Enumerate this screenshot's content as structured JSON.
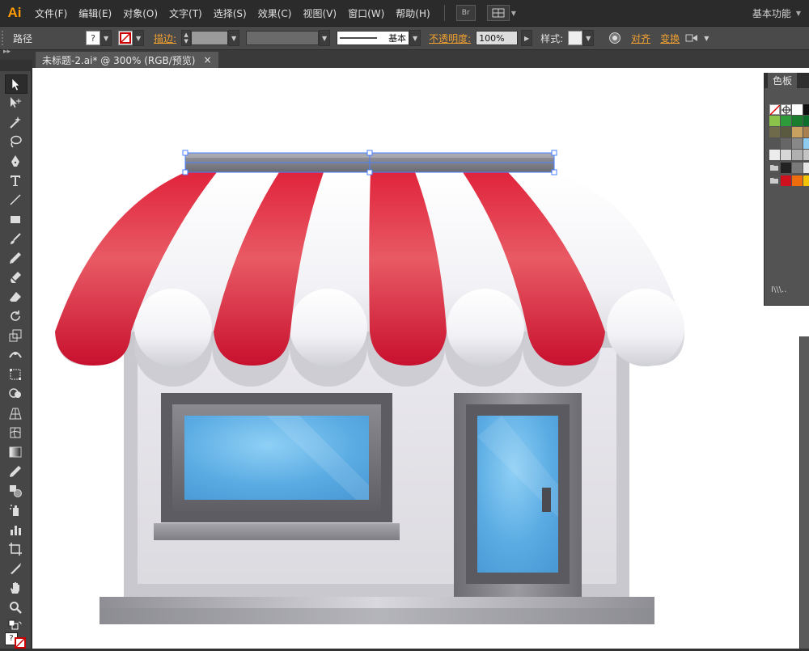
{
  "app": {
    "logo": "Ai",
    "workspace": "基本功能",
    "bridge": "Br"
  },
  "menu": [
    "文件(F)",
    "编辑(E)",
    "对象(O)",
    "文字(T)",
    "选择(S)",
    "效果(C)",
    "视图(V)",
    "窗口(W)",
    "帮助(H)"
  ],
  "control": {
    "object_type": "路径",
    "fill_symbol": "?",
    "stroke_label": "描边:",
    "stroke_profile": "基本",
    "opacity_label": "不透明度:",
    "opacity_value": "100%",
    "style_label": "样式:",
    "align_label": "对齐",
    "transform_label": "变换"
  },
  "document": {
    "tab_title": "未标题-2.ai* @ 300% (RGB/预览)",
    "close": "×"
  },
  "swatches_panel": {
    "title": "色板",
    "footer": "I\\\\\\.."
  },
  "toolbar": {
    "tools": [
      "selection-tool",
      "direct-selection-tool",
      "magic-wand-tool",
      "lasso-tool",
      "pen-tool",
      "type-tool",
      "line-tool",
      "rectangle-tool",
      "paintbrush-tool",
      "pencil-tool",
      "blob-brush-tool",
      "eraser-tool",
      "rotate-tool",
      "scale-tool",
      "width-tool",
      "free-transform-tool",
      "shape-builder-tool",
      "perspective-grid-tool",
      "mesh-tool",
      "gradient-tool",
      "eyedropper-tool",
      "blend-tool",
      "symbol-sprayer-tool",
      "column-graph-tool",
      "artboard-tool",
      "slice-tool",
      "hand-tool",
      "zoom-tool"
    ],
    "selected": "selection-tool",
    "fill_stroke_symbol": "?"
  },
  "colors": {
    "awning_red": "#d8203a",
    "awning_white": "#f4f4f6",
    "wall": "#e4e3e8",
    "glass": "#5aabe3",
    "frame": "#6a6a70",
    "ui_orange": "#f0a030"
  }
}
